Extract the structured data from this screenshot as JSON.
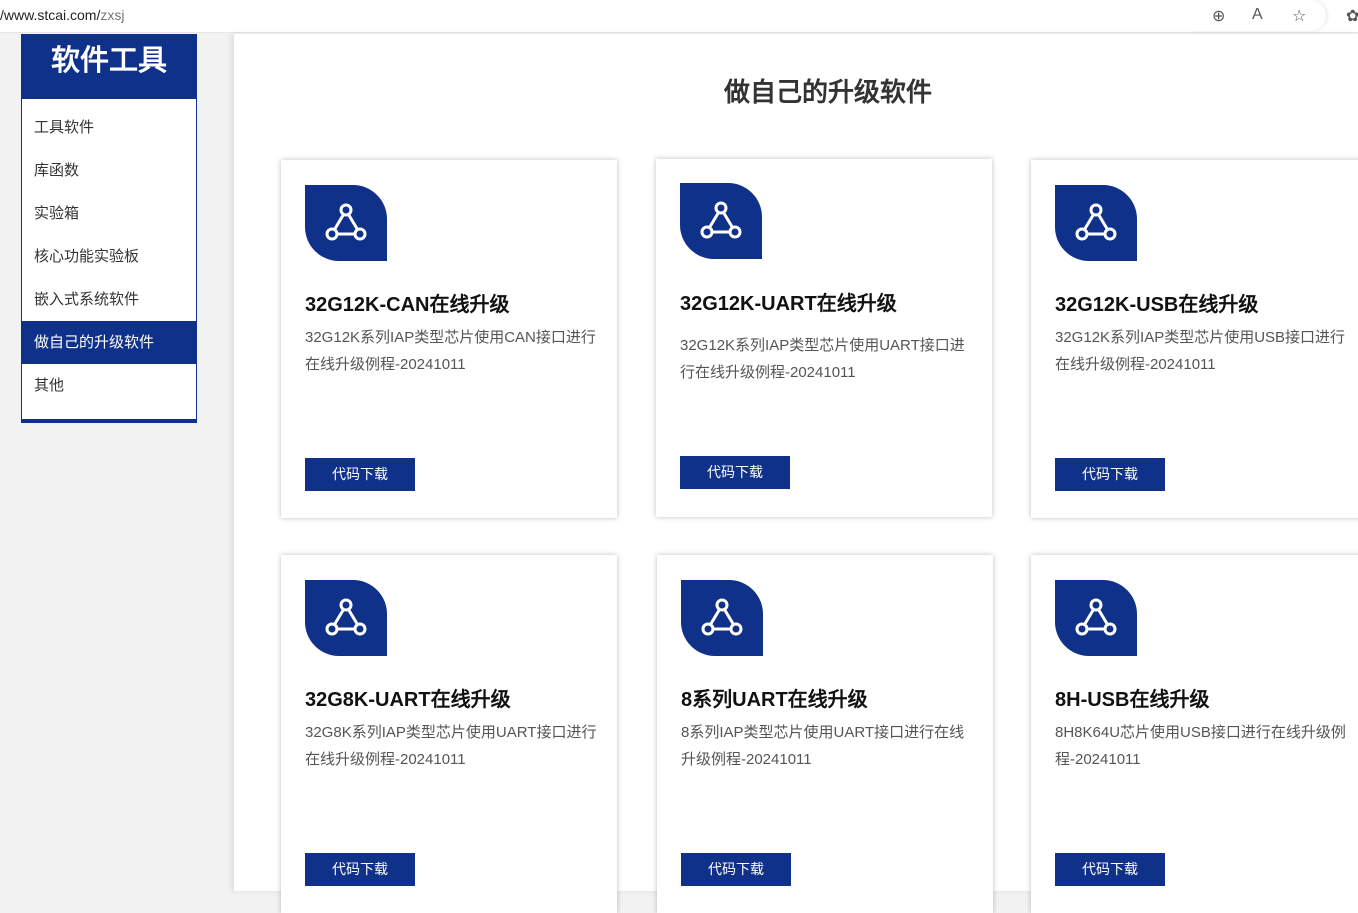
{
  "browser": {
    "url_host": "/www.stcai.com/",
    "url_path": "zxsj"
  },
  "sidebar": {
    "title": "软件工具",
    "items": [
      {
        "label": "工具软件"
      },
      {
        "label": "库函数"
      },
      {
        "label": "实验箱"
      },
      {
        "label": "核心功能实验板"
      },
      {
        "label": "嵌入式系统软件"
      },
      {
        "label": "做自己的升级软件",
        "active": true
      },
      {
        "label": "其他"
      }
    ]
  },
  "main": {
    "title": "做自己的升级软件",
    "cards": [
      {
        "title": "32G12K-CAN在线升级",
        "desc": "32G12K系列IAP类型芯片使用CAN接口进行在线升级例程-20241011",
        "button": "代码下载"
      },
      {
        "title": "32G12K-UART在线升级",
        "desc": "32G12K系列IAP类型芯片使用UART接口进行在线升级例程-20241011",
        "button": "代码下载"
      },
      {
        "title": "32G12K-USB在线升级",
        "desc": "32G12K系列IAP类型芯片使用USB接口进行在线升级例程-20241011",
        "button": "代码下载"
      },
      {
        "title": "32G8K-UART在线升级",
        "desc": "32G8K系列IAP类型芯片使用UART接口进行在线升级例程-20241011",
        "button": "代码下载"
      },
      {
        "title": "8系列UART在线升级",
        "desc": "8系列IAP类型芯片使用UART接口进行在线升级例程-20241011",
        "button": "代码下载"
      },
      {
        "title": "8H-USB在线升级",
        "desc": "8H8K64U芯片使用USB接口进行在线升级例程-20241011",
        "button": "代码下载"
      }
    ]
  },
  "colors": {
    "brand": "#10318a"
  }
}
